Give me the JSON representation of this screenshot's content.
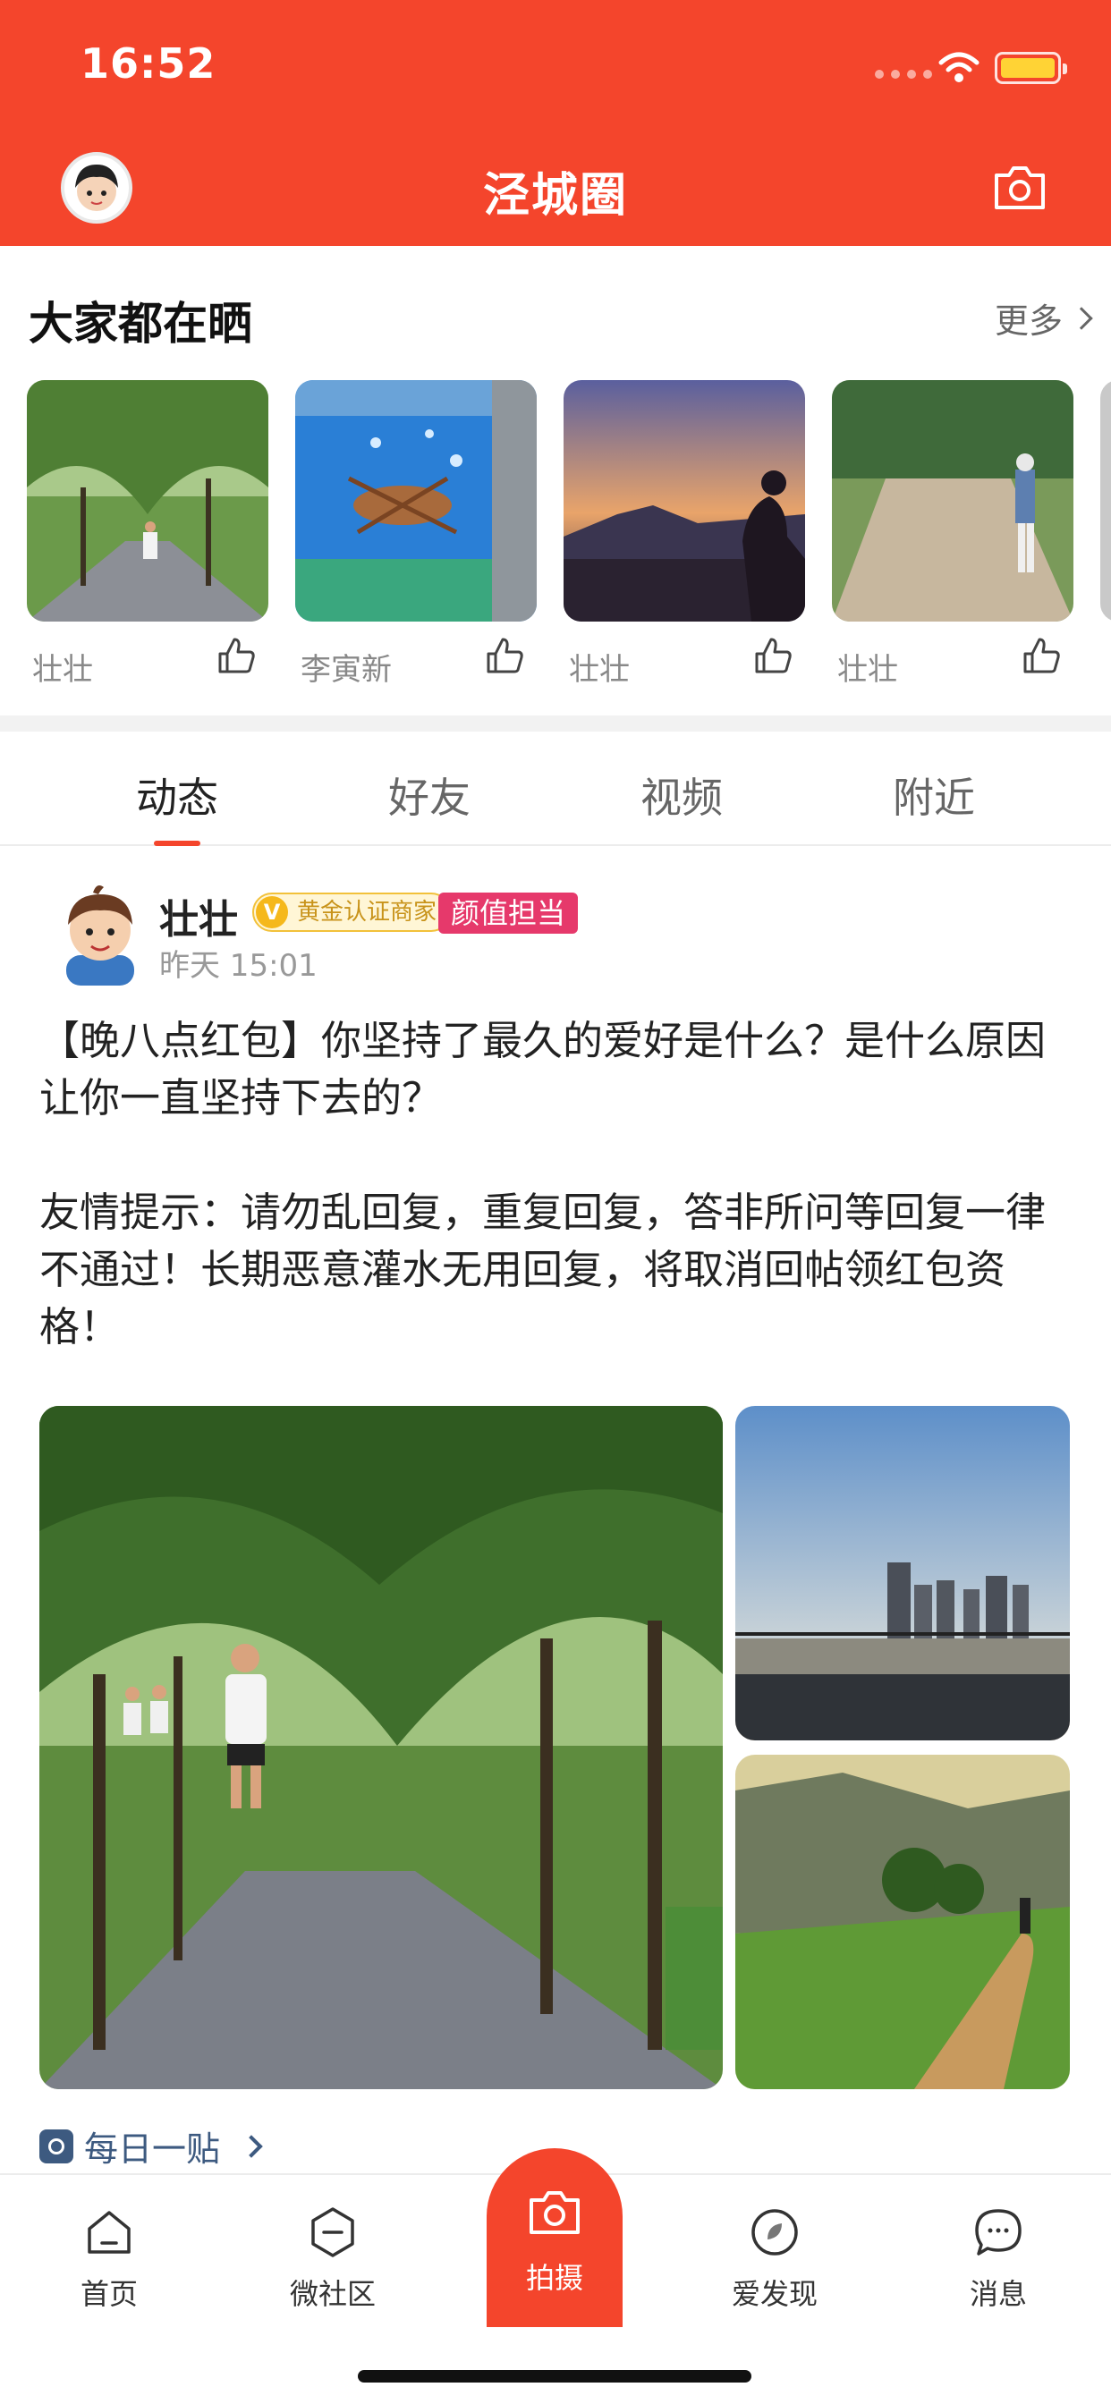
{
  "status_bar": {
    "time": "16:52"
  },
  "header": {
    "title": "泾城圈"
  },
  "sharing": {
    "title": "大家都在晒",
    "more_label": "更多",
    "cards": [
      {
        "name": "壮壮"
      },
      {
        "name": "李寅新"
      },
      {
        "name": "壮壮"
      },
      {
        "name": "壮壮"
      }
    ]
  },
  "tabs": [
    {
      "label": "动态"
    },
    {
      "label": "好友"
    },
    {
      "label": "视频"
    },
    {
      "label": "附近"
    }
  ],
  "post": {
    "user": "壮壮",
    "gold_badge": "黄金认证商家",
    "gold_badge_mark": "V",
    "tag": "颜值担当",
    "time": "昨天 15:01",
    "text": "【晚八点红包】你坚持了最久的爱好是什么？是什么原因让你一直坚持下去的？\n\n友情提示：请勿乱回复，重复回复，答非所问等回复一律不通过！长期恶意灌水无用回复，将取消回帖领红包资格！",
    "daily_label": "每日一贴"
  },
  "bottom_nav": {
    "items": [
      {
        "label": "首页",
        "icon": "home-icon"
      },
      {
        "label": "微社区",
        "icon": "community-icon"
      },
      {
        "label": "拍摄",
        "icon": "camera-icon"
      },
      {
        "label": "爱发现",
        "icon": "discover-icon"
      },
      {
        "label": "消息",
        "icon": "message-icon"
      }
    ]
  },
  "colors": {
    "brand": "#f4452c",
    "tag": "#e6396b",
    "gold": "#f5b81c"
  }
}
